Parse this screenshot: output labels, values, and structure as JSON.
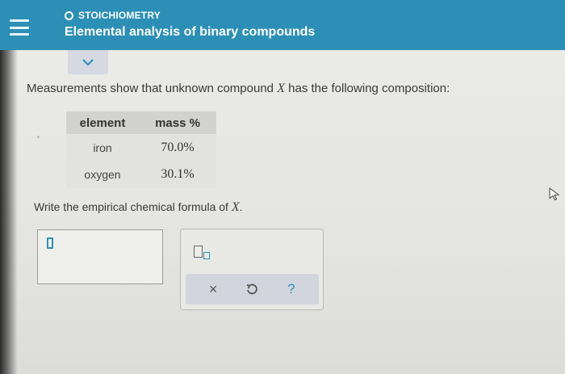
{
  "header": {
    "topic": "STOICHIOMETRY",
    "title": "Elemental analysis of binary compounds"
  },
  "problem": {
    "intro_before": "Measurements show that unknown compound ",
    "intro_var": "X",
    "intro_after": " has the following composition:",
    "table": {
      "headers": [
        "element",
        "mass %"
      ],
      "rows": [
        {
          "element": "iron",
          "mass": "70.0%"
        },
        {
          "element": "oxygen",
          "mass": "30.1%"
        }
      ]
    },
    "question_before": "Write the empirical chemical formula of ",
    "question_var": "X",
    "question_after": "."
  },
  "answer": {
    "value": ""
  },
  "tools": {
    "subscript_icon": "subscript-box-icon",
    "clear_label": "×",
    "undo_icon": "undo-icon",
    "help_label": "?"
  },
  "colors": {
    "header_bg": "#2c8fb6",
    "accent": "#2c8fb6",
    "action_bar_bg": "#d3d5de"
  }
}
